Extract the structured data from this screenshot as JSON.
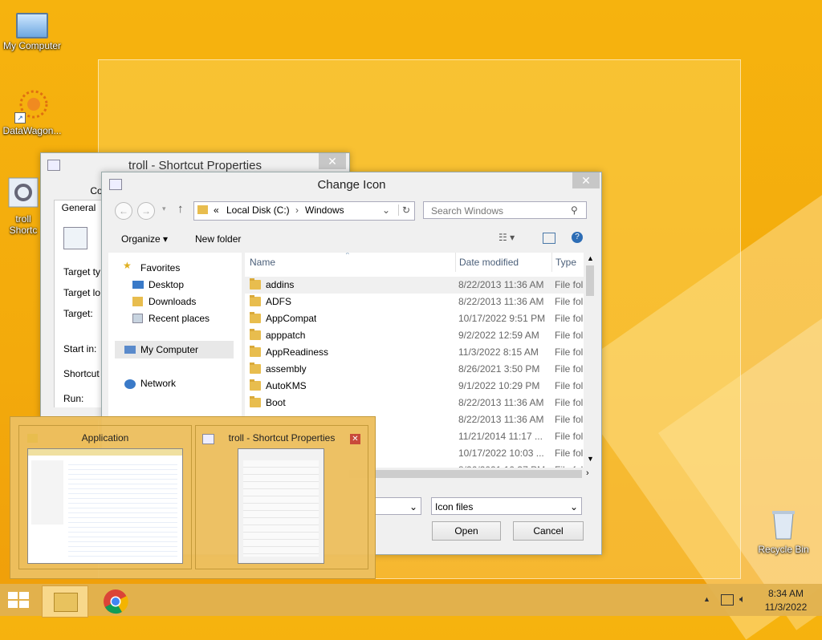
{
  "desktop": {
    "icons": [
      {
        "label": "My Computer",
        "icon": "computer-icon"
      },
      {
        "label": "DataWagon...",
        "icon": "datawagon-icon"
      },
      {
        "label": "troll",
        "label2": "Shortc",
        "icon": "settings-shortcut-icon"
      },
      {
        "label": "Recycle Bin",
        "icon": "recycle-bin-icon"
      }
    ]
  },
  "props_window": {
    "title": "troll - Shortcut Properties",
    "tabs": [
      "Colo",
      "General"
    ],
    "fields": [
      "Target ty",
      "Target lo",
      "Target:",
      "Start in:",
      "Shortcut",
      "Run:"
    ]
  },
  "change_icon": {
    "title": "Change Icon",
    "address": {
      "prefix": "«",
      "crumb1": "Local Disk (C:)",
      "sep": "›",
      "crumb2": "Windows"
    },
    "search_placeholder": "Search Windows",
    "organize_label": "Organize",
    "new_folder_label": "New folder",
    "nav": {
      "favorites": "Favorites",
      "desktop": "Desktop",
      "downloads": "Downloads",
      "recent": "Recent places",
      "computer": "My Computer",
      "network": "Network"
    },
    "columns": {
      "name": "Name",
      "date": "Date modified",
      "type": "Type"
    },
    "files": [
      {
        "name": "addins",
        "date": "8/22/2013 11:36 AM",
        "type": "File fol"
      },
      {
        "name": "ADFS",
        "date": "8/22/2013 11:36 AM",
        "type": "File fol"
      },
      {
        "name": "AppCompat",
        "date": "10/17/2022 9:51 PM",
        "type": "File fol"
      },
      {
        "name": "apppatch",
        "date": "9/2/2022 12:59 AM",
        "type": "File fol"
      },
      {
        "name": "AppReadiness",
        "date": "11/3/2022 8:15 AM",
        "type": "File fol"
      },
      {
        "name": "assembly",
        "date": "8/26/2021 3:50 PM",
        "type": "File fol"
      },
      {
        "name": "AutoKMS",
        "date": "9/1/2022 10:29 PM",
        "type": "File fol"
      },
      {
        "name": "Boot",
        "date": "8/22/2013 11:36 AM",
        "type": "File fol"
      },
      {
        "name": "",
        "date": "8/22/2013 11:36 AM",
        "type": "File fol"
      },
      {
        "name": "",
        "date": "11/21/2014 11:17 ...",
        "type": "File fol"
      },
      {
        "name": "",
        "date": "10/17/2022 10:03 ...",
        "type": "File fol"
      },
      {
        "name": "",
        "date": "8/26/2021 10:37 PM",
        "type": "File fol"
      }
    ],
    "filetype": "Icon files",
    "open_label": "Open",
    "cancel_label": "Cancel"
  },
  "task_switcher": {
    "items": [
      {
        "title": "Application"
      },
      {
        "title": "troll - Shortcut Properties"
      }
    ]
  },
  "taskbar": {
    "time": "8:34 AM",
    "date": "11/3/2022"
  },
  "colors": {
    "accent": "#f6b30e",
    "selection": "#cce8ff"
  }
}
